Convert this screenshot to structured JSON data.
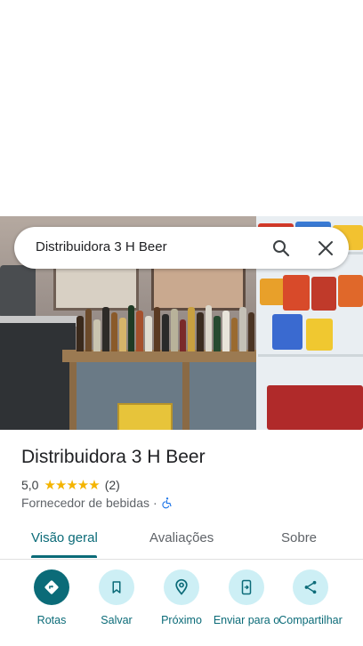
{
  "search": {
    "query": "Distribuidora 3 H Beer"
  },
  "place": {
    "title": "Distribuidora 3 H Beer",
    "rating": "5,0",
    "stars": "★★★★★",
    "review_count": "(2)",
    "category": "Fornecedor de bebidas",
    "separator": "·",
    "accessibility_icon": "wheelchair-icon"
  },
  "tabs": [
    {
      "label": "Visão geral",
      "active": true
    },
    {
      "label": "Avaliações",
      "active": false
    },
    {
      "label": "Sobre",
      "active": false
    }
  ],
  "actions": [
    {
      "label": "Rotas",
      "icon": "directions-icon"
    },
    {
      "label": "Salvar",
      "icon": "bookmark-icon"
    },
    {
      "label": "Próximo",
      "icon": "nearby-icon"
    },
    {
      "label": "Enviar para o",
      "icon": "send-to-phone-icon"
    },
    {
      "label": "Compartilhar",
      "icon": "share-icon"
    }
  ],
  "colors": {
    "accent": "#0b6b78",
    "action_bg": "#cdeff5",
    "star": "#f4b400",
    "accessibility": "#1a73e8"
  }
}
